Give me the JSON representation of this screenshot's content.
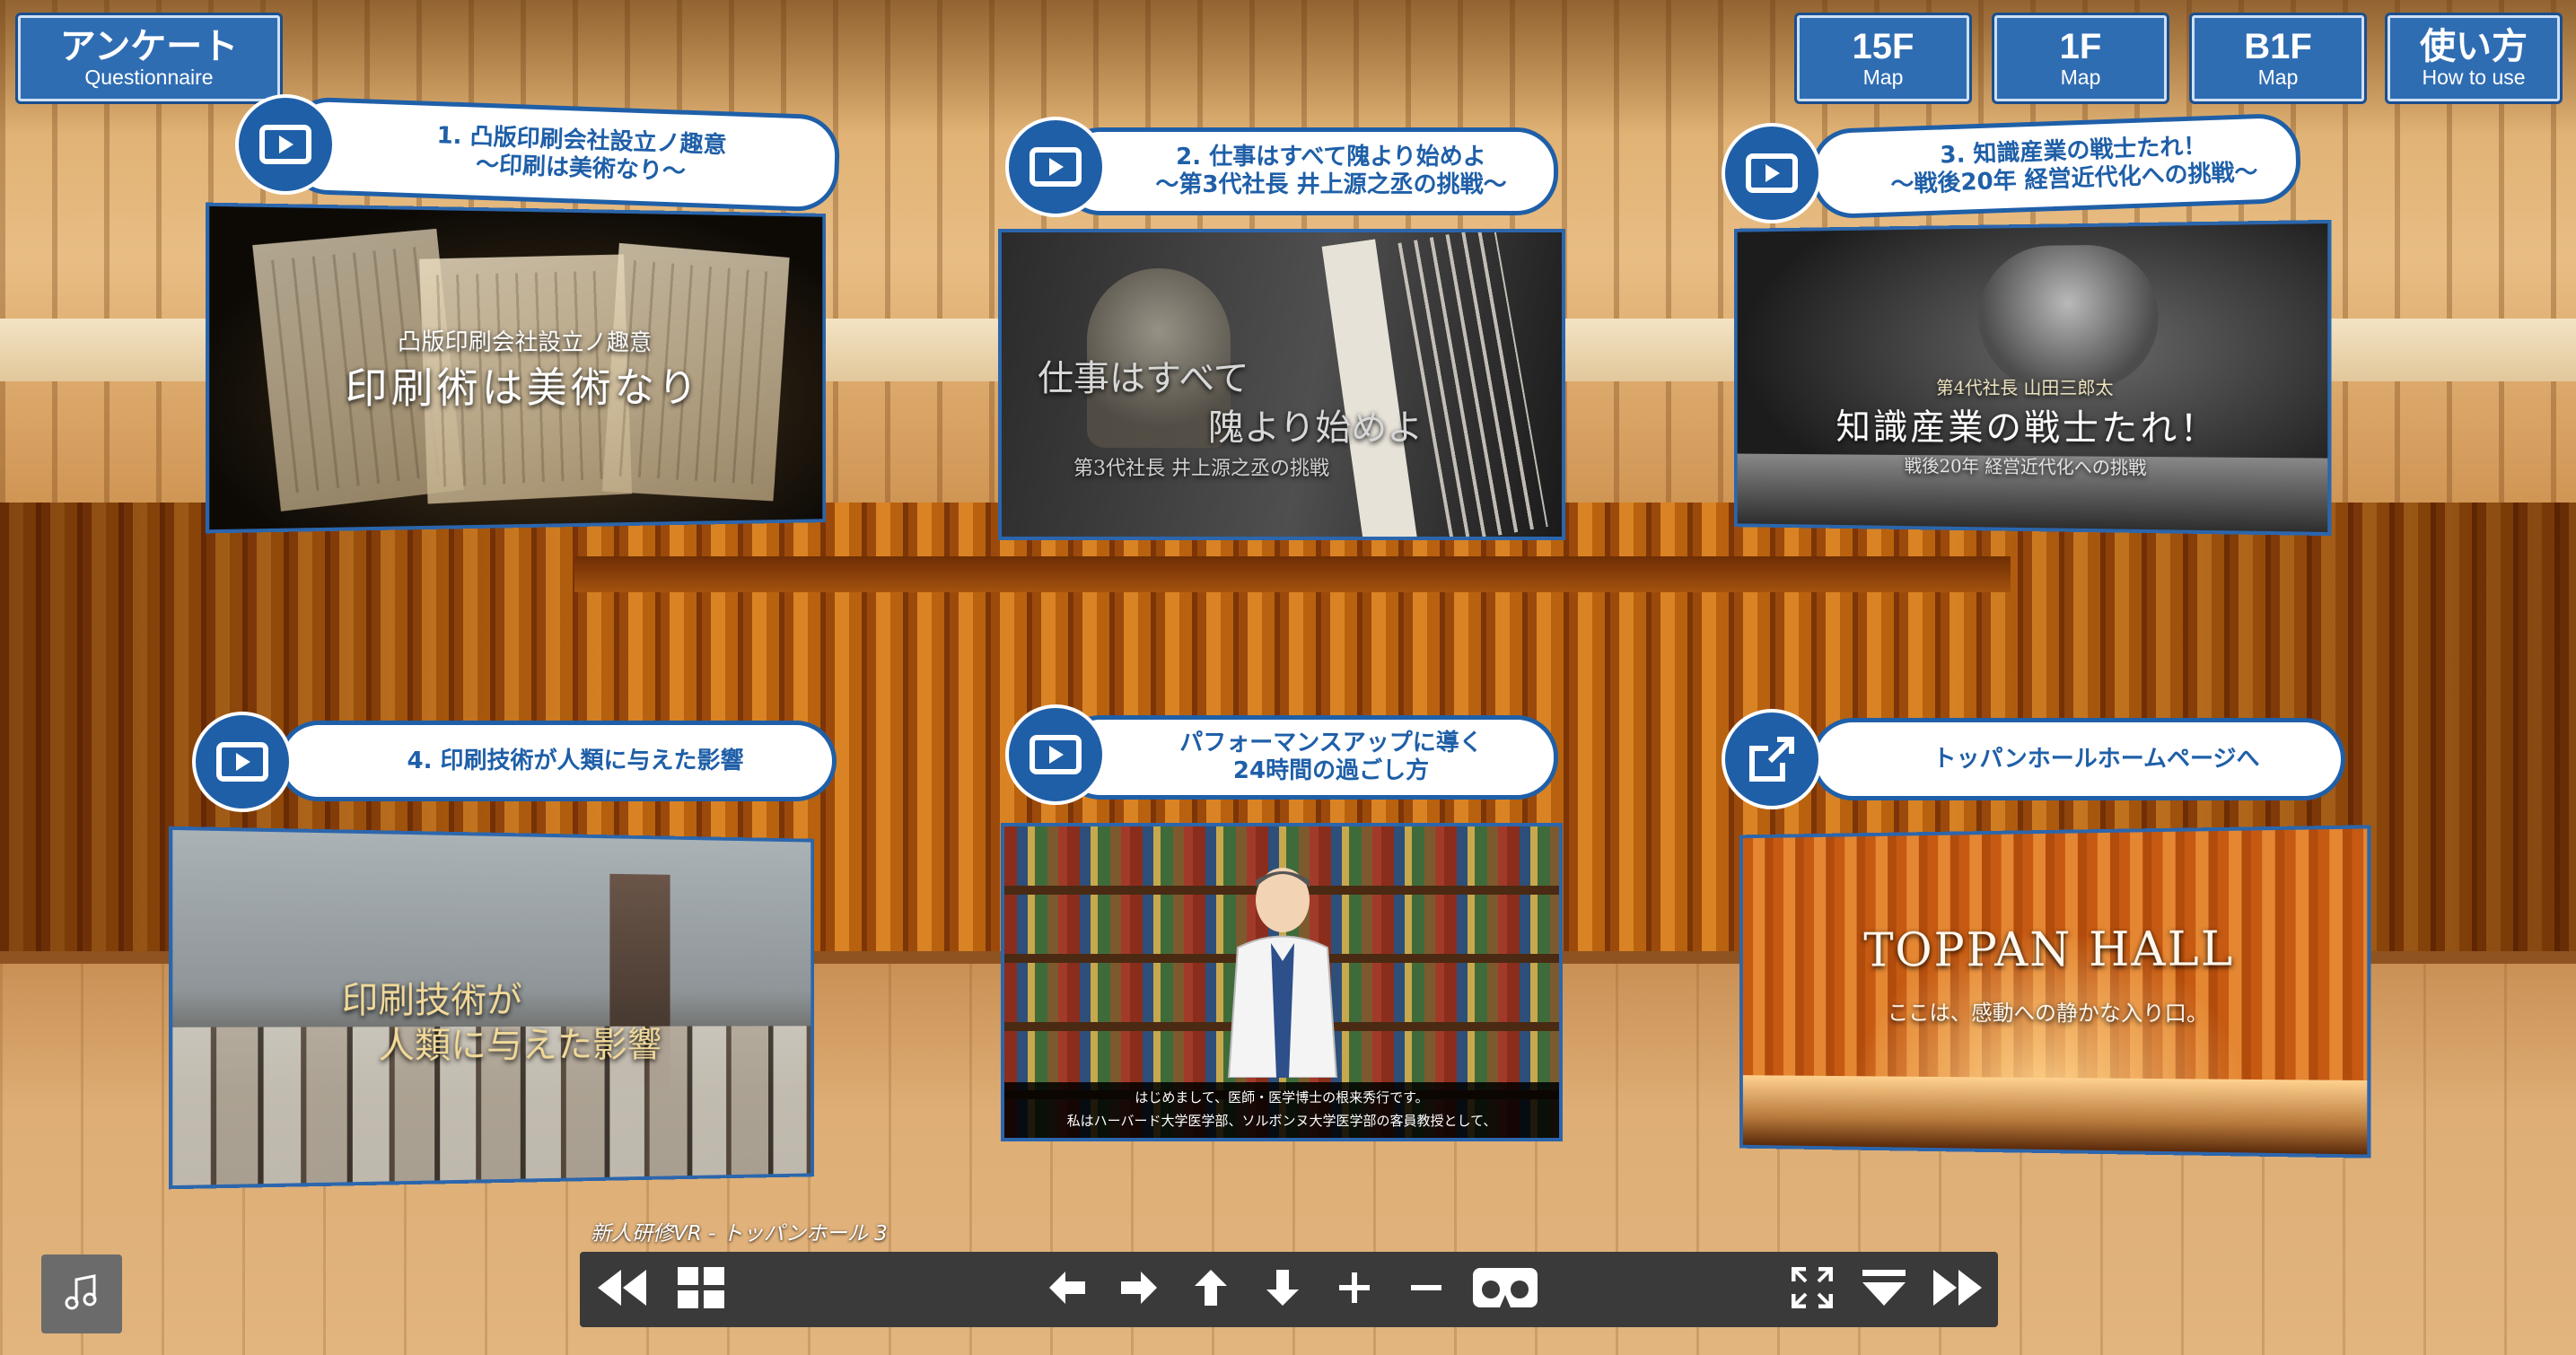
{
  "survey_button": {
    "title": "アンケート",
    "subtitle": "Questionnaire"
  },
  "nav_buttons": [
    {
      "title": "15F",
      "subtitle": "Map"
    },
    {
      "title": "1F",
      "subtitle": "Map"
    },
    {
      "title": "B1F",
      "subtitle": "Map"
    },
    {
      "title": "使い方",
      "subtitle": "How to use"
    }
  ],
  "hotspots": [
    {
      "label_line1": "1. 凸版印刷会社設立ノ趣意",
      "label_line2": "〜印刷は美術なり〜",
      "thumb_caption_small": "凸版印刷会社設立ノ趣意",
      "thumb_caption_large": "印刷術は美術なり"
    },
    {
      "label_line1": "2. 仕事はすべて隗より始めよ",
      "label_line2": "〜第3代社長 井上源之丞の挑戦〜",
      "thumb_caption_line1": "仕事はすべて",
      "thumb_caption_line2": "隗より始めよ",
      "thumb_caption_line3": "第3代社長 井上源之丞の挑戦"
    },
    {
      "label_line1": "3. 知識産業の戦士たれ！",
      "label_line2": "〜戦後20年 経営近代化への挑戦〜",
      "thumb_caption_line1": "第4代社長 山田三郎太",
      "thumb_caption_line2": "知識産業の戦士たれ！",
      "thumb_caption_line3": "戦後20年 経営近代化への挑戦"
    },
    {
      "label_line1": "4. 印刷技術が人類に与えた影響",
      "thumb_caption_line1": "印刷技術が",
      "thumb_caption_line2": "人類に与えた影響"
    },
    {
      "label_line1": "パフォーマンスアップに導く",
      "label_line2": "24時間の過ごし方",
      "subtitle_line1": "はじめまして、医師・医学博士の根来秀行です。",
      "subtitle_line2": "私はハーバード大学医学部、ソルボンヌ大学医学部の客員教授として、"
    },
    {
      "label_line1": "トッパンホールホームページへ",
      "thumb_caption_line1": "TOPPAN HALL",
      "thumb_caption_line2": "ここは、感動への静かな入り口。"
    }
  ],
  "tour_title": "新人研修VR - トッパンホール 3",
  "toolbar_icons": [
    "rewind-icon",
    "grid-icon",
    "arrow-left-icon",
    "arrow-right-icon",
    "arrow-up-icon",
    "arrow-down-icon",
    "zoom-in-icon",
    "zoom-out-icon",
    "vr-goggles-icon",
    "fullscreen-icon",
    "hide-bar-icon",
    "fast-forward-icon"
  ],
  "colors": {
    "accent": "#1f5fa8",
    "button_bg": "#2f6db3",
    "toolbar_bg": "#3a3a3a"
  }
}
